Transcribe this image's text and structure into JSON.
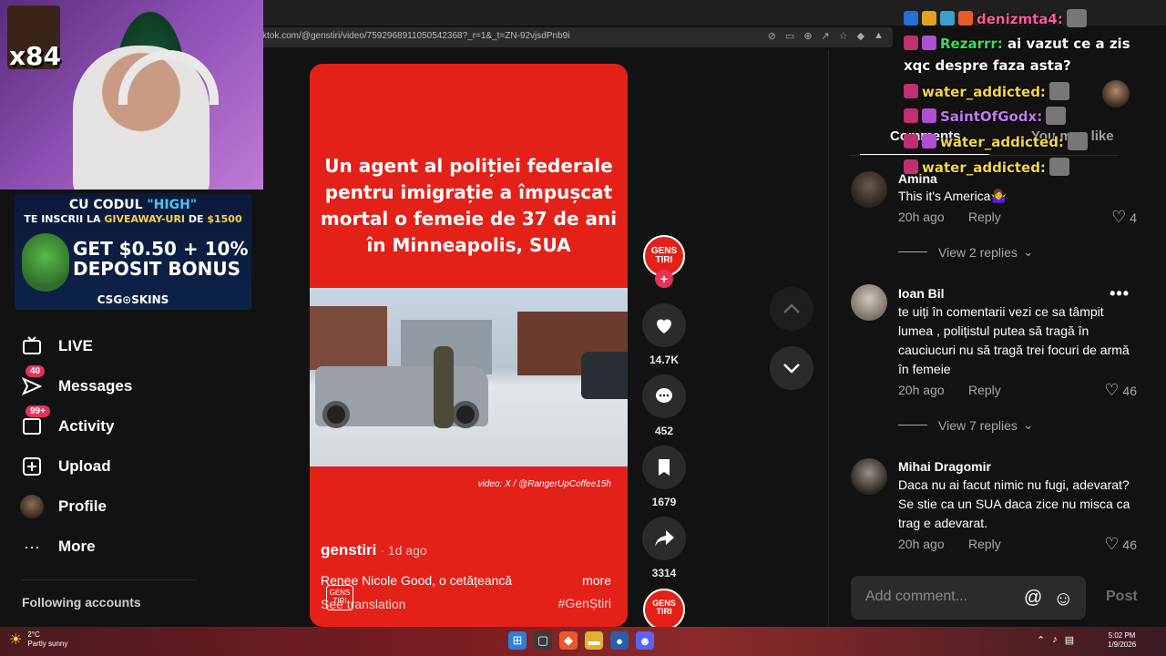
{
  "browser": {
    "url": "ktok.com/@genstiri/video/7592968911050542368?_r=1&_t=ZN-92vjsdPnb9i"
  },
  "sidebar": {
    "items": [
      {
        "label": "LIVE",
        "icon": "live-icon"
      },
      {
        "label": "Messages",
        "icon": "messages-icon",
        "badge": "40"
      },
      {
        "label": "Activity",
        "icon": "activity-icon",
        "badge": "99+"
      },
      {
        "label": "Upload",
        "icon": "upload-icon"
      },
      {
        "label": "Profile",
        "icon": "profile-avatar"
      },
      {
        "label": "More",
        "icon": "more-icon"
      }
    ],
    "following_label": "Following accounts"
  },
  "overlay": {
    "multiplier": "x84",
    "promo": {
      "line1_a": "CU CODUL ",
      "line1_b": "\"HIGH\"",
      "line2_a": "TE INSCRII LA ",
      "line2_b": "GIVEAWAY-URI",
      "line2_c": " DE ",
      "line2_d": "$1500",
      "line3": "GET $0.50 + 10%",
      "line4": "DEPOSIT BONUS",
      "footer": "CSG⊙SKINS"
    }
  },
  "video": {
    "headline": "Un agent al poliției federale pentru imigrație a împușcat mortal o femeie de 37 de ani în Minneapolis, SUA",
    "credit": "video: X / @RangerUpCoffee15h",
    "username": "genstiri",
    "age": " · 1d ago",
    "caption": "Renee Nicole Good, o cetățeancă",
    "more": "more",
    "see_translation": "See translation",
    "hashtag": "#GenȘtiri",
    "logo_text": "GENS TIRI"
  },
  "actions": {
    "likes": "14.7K",
    "comments": "452",
    "saves": "1679",
    "shares": "3314"
  },
  "comments_panel": {
    "tab_comments": "Comments",
    "tab_like": "You may like",
    "comments": [
      {
        "name": "Amina",
        "text": "This it's America🤷‍♀️",
        "time": "20h ago",
        "reply": "Reply",
        "likes": "4",
        "view_replies": "View 2 replies"
      },
      {
        "name": "Ioan Bil",
        "text": "te uiți în comentarii vezi ce sa tâmpit lumea , polițistul putea să tragă în cauciucuri nu să tragă trei focuri de armă în femeie",
        "time": "20h ago",
        "reply": "Reply",
        "likes": "46",
        "view_replies": "View 7 replies"
      },
      {
        "name": "Mihai Dragomir",
        "text": "Daca nu ai facut nimic nu fugi, adevarat? Se stie ca un SUA daca zice nu misca ca trag e adevarat.",
        "time": "20h ago",
        "reply": "Reply",
        "likes": "46"
      }
    ],
    "input_placeholder": "Add comment...",
    "post": "Post"
  },
  "chat": {
    "lines": [
      {
        "name": "denizmta4:",
        "msg": "",
        "color": "#ff5aa0"
      },
      {
        "name": "Rezarrr:",
        "msg": " ai vazut ce a zis",
        "color": "#3ddc5a"
      },
      {
        "name": "",
        "msg": "xqc despre faza asta?",
        "color": "#ffffff"
      },
      {
        "name": "water_addicted:",
        "msg": "",
        "color": "#f5d742"
      },
      {
        "name": "SaintOfGodx:",
        "msg": "",
        "color": "#c07af0"
      },
      {
        "name": "water_addicted:",
        "msg": "",
        "color": "#f5d742"
      },
      {
        "name": "water_addicted:",
        "msg": "",
        "color": "#f5d742"
      }
    ]
  },
  "taskbar": {
    "temp": "2°C",
    "weather": "Partly sunny",
    "time": "5:02 PM",
    "date": "1/9/2026"
  }
}
